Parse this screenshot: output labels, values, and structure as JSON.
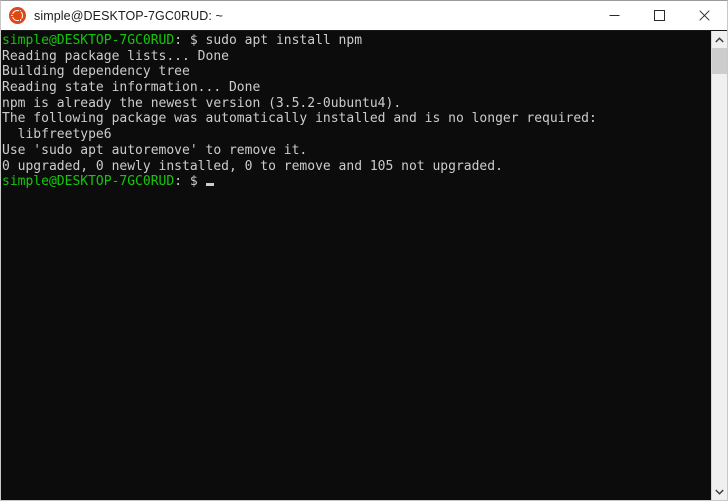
{
  "window": {
    "title": "simple@DESKTOP-7GC0RUD: ~",
    "icon": "ubuntu-logo-icon",
    "minimize_label": "Minimize",
    "maximize_label": "Maximize",
    "close_label": "Close"
  },
  "terminal": {
    "background_color": "#0c0c0c",
    "foreground_color": "#cccccc",
    "prompt_color": "#16c60c",
    "prompt_user_host": "simple@DESKTOP-7GC0RUD",
    "prompt_separator": ":",
    "prompt_symbol": "$",
    "lines": [
      {
        "type": "prompt",
        "user_host": "simple@DESKTOP-7GC0RUD",
        "separator": ":",
        "symbol": "$",
        "command": "sudo apt install npm"
      },
      {
        "type": "output",
        "text": "Reading package lists... Done"
      },
      {
        "type": "output",
        "text": "Building dependency tree"
      },
      {
        "type": "output",
        "text": "Reading state information... Done"
      },
      {
        "type": "output",
        "text": "npm is already the newest version (3.5.2-0ubuntu4)."
      },
      {
        "type": "output",
        "text": "The following package was automatically installed and is no longer required:"
      },
      {
        "type": "output",
        "text": "  libfreetype6"
      },
      {
        "type": "output",
        "text": "Use 'sudo apt autoremove' to remove it."
      },
      {
        "type": "output",
        "text": "0 upgraded, 0 newly installed, 0 to remove and 105 not upgraded."
      },
      {
        "type": "prompt",
        "user_host": "simple@DESKTOP-7GC0RUD",
        "separator": ":",
        "symbol": "$",
        "command": "",
        "cursor": true
      }
    ]
  },
  "scrollbar": {
    "up_arrow": "chevron-up-icon",
    "down_arrow": "chevron-down-icon",
    "thumb_position_percent": 0,
    "thumb_size_percent": 6
  }
}
